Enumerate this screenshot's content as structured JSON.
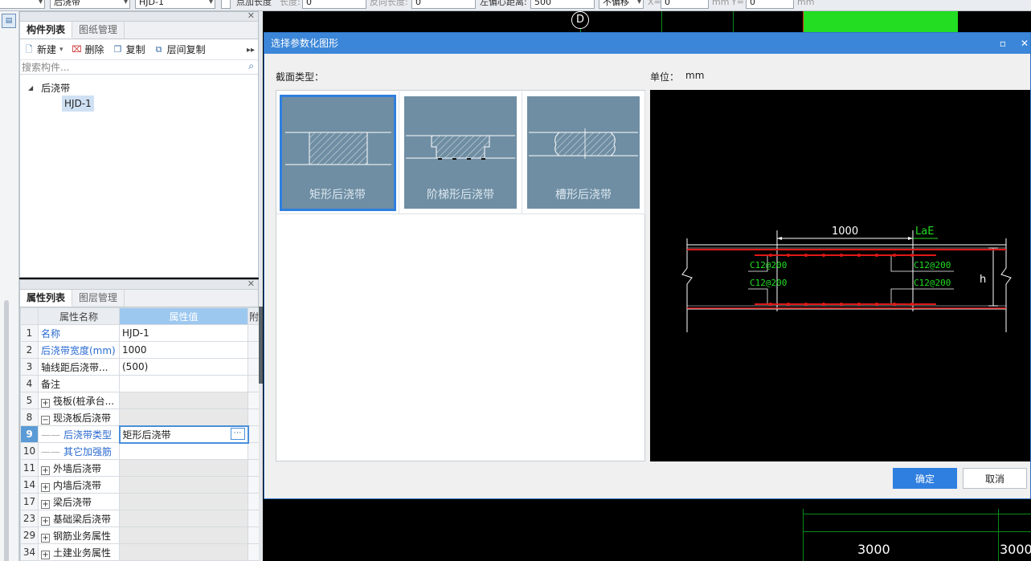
{
  "toolbar": {
    "type_value": "后浇带",
    "name_value": "HJD-1",
    "checkbox_label": "点加长度",
    "length_label": "长度:",
    "length_value": "0",
    "reverse_length_label": "反向长度:",
    "reverse_length_value": "0",
    "left_offset_label": "左偏心距离:",
    "left_offset_value": "500",
    "offset_mode_value": "不偏移",
    "x_label": "X=",
    "x_value": "0",
    "x_unit": "mm",
    "y_label": "Y=",
    "y_value": "0",
    "y_unit": "mm"
  },
  "component_panel": {
    "tabs": [
      "构件列表",
      "图纸管理"
    ],
    "actions": {
      "new_label": "新建",
      "delete_label": "删除",
      "copy_label": "复制",
      "floor_copy_label": "层间复制"
    },
    "search_placeholder": "搜索构件...",
    "tree_root": "后浇带",
    "tree_child": "HJD-1"
  },
  "property_panel": {
    "tabs": [
      "属性列表",
      "图层管理"
    ],
    "columns": {
      "name": "属性名称",
      "value": "属性值",
      "extra": "附"
    },
    "rows": [
      {
        "num": "1",
        "name": "名称",
        "value": "HJD-1"
      },
      {
        "num": "2",
        "name": "后浇带宽度(mm)",
        "value": "1000"
      },
      {
        "num": "3",
        "name": "轴线距后浇带...",
        "value": "(500)"
      },
      {
        "num": "4",
        "name": "备注",
        "value": ""
      },
      {
        "num": "5",
        "name": "筏板(桩承台...",
        "value": ""
      },
      {
        "num": "8",
        "name": "现浇板后浇带",
        "value": ""
      },
      {
        "num": "9",
        "name": "后浇带类型",
        "value": "矩形后浇带"
      },
      {
        "num": "10",
        "name": "其它加强筋",
        "value": ""
      },
      {
        "num": "11",
        "name": "外墙后浇带",
        "value": ""
      },
      {
        "num": "14",
        "name": "内墙后浇带",
        "value": ""
      },
      {
        "num": "17",
        "name": "梁后浇带",
        "value": ""
      },
      {
        "num": "23",
        "name": "基础梁后浇带",
        "value": ""
      },
      {
        "num": "29",
        "name": "钢筋业务属性",
        "value": ""
      },
      {
        "num": "34",
        "name": "土建业务属性",
        "value": ""
      }
    ]
  },
  "dialog": {
    "title": "选择参数化图形",
    "section_label": "截面类型：",
    "unit_label": "单位：",
    "unit_value": "mm",
    "shapes": [
      "矩形后浇带",
      "阶梯形后浇带",
      "槽形后浇带"
    ],
    "selected_shape": "矩形后浇带",
    "ok_label": "确定",
    "cancel_label": "取消"
  },
  "preview": {
    "width_label": "1000",
    "lae_label": "LaE",
    "rebar_labels": [
      "C12@200",
      "C12@200",
      "C12@200",
      "C12@200"
    ],
    "height_label": "h"
  },
  "canvas": {
    "axis_label": "D",
    "dim_value_1": "3000",
    "dim_value_2": "3000"
  },
  "colors": {
    "accent": "#2f7fe0",
    "title_bar": "#3b86d8",
    "tile_bg": "#6f8ea3",
    "rebar_red": "#e01818",
    "label_green": "#22dd22"
  }
}
